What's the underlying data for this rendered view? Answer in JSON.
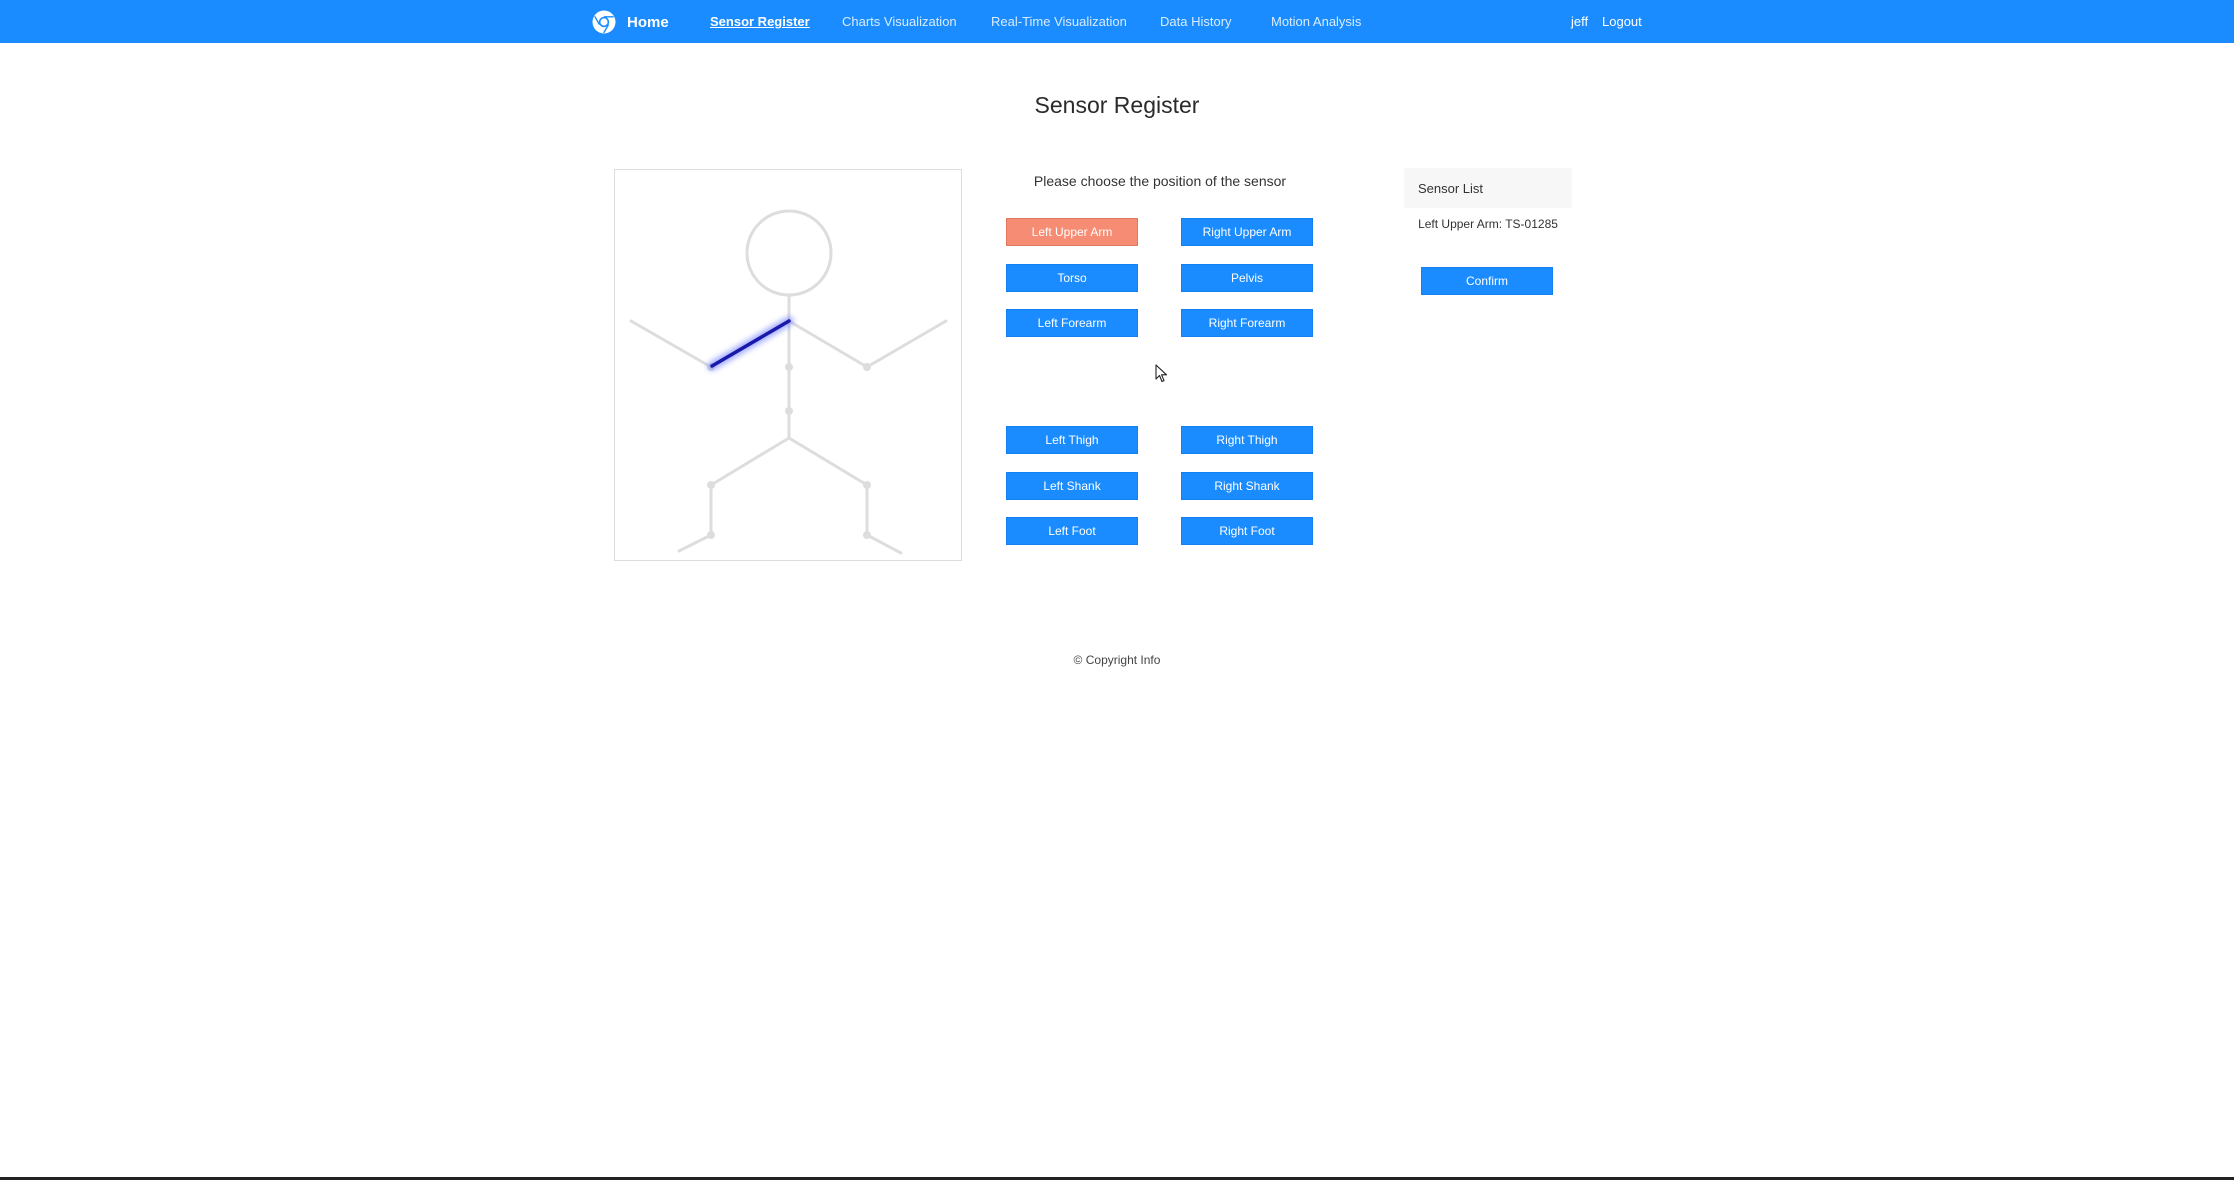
{
  "nav": {
    "brand": "Home",
    "links": [
      {
        "label": "Sensor Register",
        "active": true
      },
      {
        "label": "Charts Visualization",
        "active": false
      },
      {
        "label": "Real-Time Visualization",
        "active": false
      },
      {
        "label": "Data History",
        "active": false
      },
      {
        "label": "Motion Analysis",
        "active": false
      }
    ],
    "user": "jeff",
    "logout": "Logout"
  },
  "page": {
    "title": "Sensor Register",
    "prompt": "Please choose the position of the sensor"
  },
  "figure": {
    "highlighted_segment": "Left Upper Arm",
    "highlight_color": "#1a1aff",
    "limb_color": "#dddddd"
  },
  "positions": {
    "left_upper_arm": "Left Upper Arm",
    "right_upper_arm": "Right Upper Arm",
    "torso": "Torso",
    "pelvis": "Pelvis",
    "left_forearm": "Left Forearm",
    "right_forearm": "Right Forearm",
    "left_thigh": "Left Thigh",
    "right_thigh": "Right Thigh",
    "left_shank": "Left Shank",
    "right_shank": "Right Shank",
    "left_foot": "Left Foot",
    "right_foot": "Right Foot",
    "selected": "Left Upper Arm"
  },
  "sensor_list": {
    "header": "Sensor List",
    "items": [
      "Left Upper Arm: TS-01285"
    ],
    "confirm": "Confirm"
  },
  "footer": {
    "text": "© Copyright Info"
  },
  "colors": {
    "primary": "#1a8cff",
    "selected": "#f58c73"
  }
}
